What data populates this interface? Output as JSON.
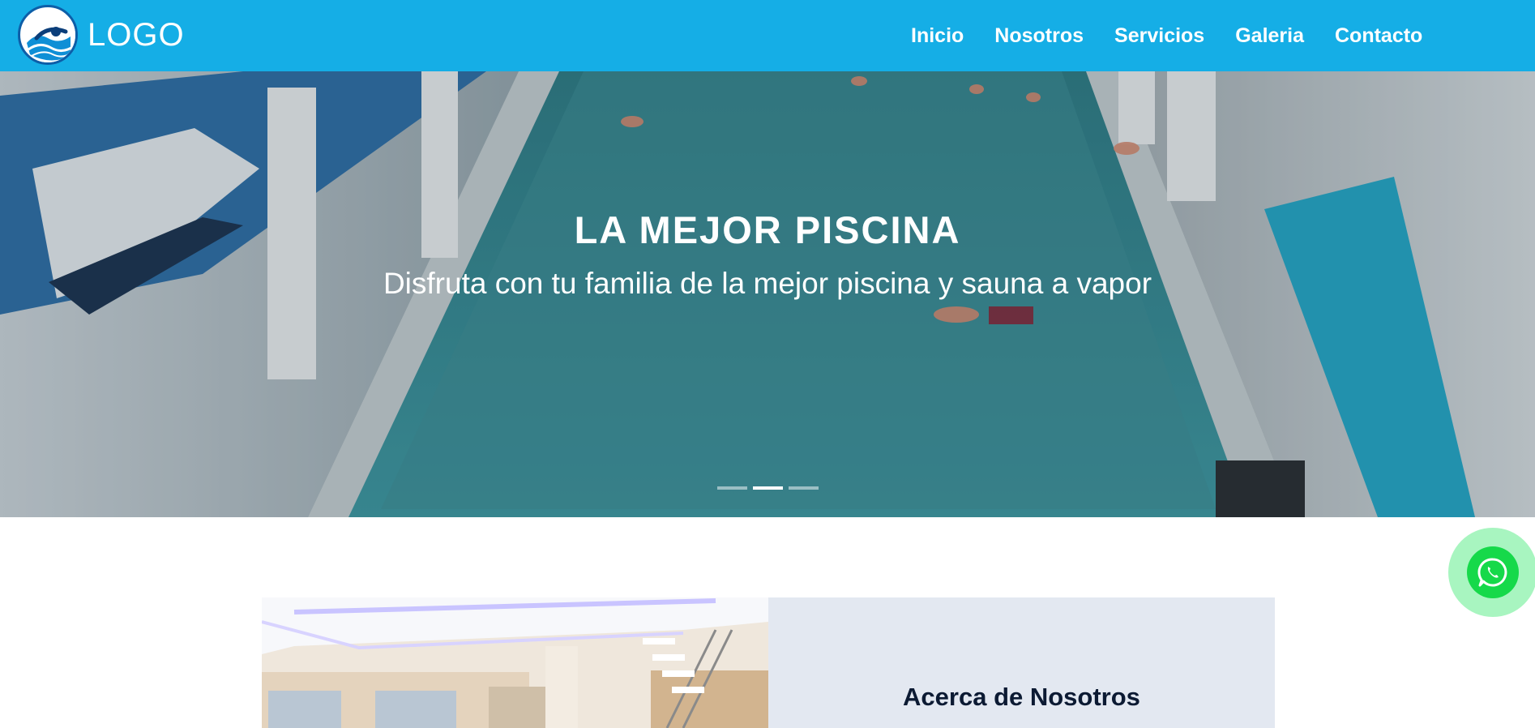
{
  "brand": {
    "logo_text": "LOGO",
    "logo_icon": "swimmer-wave-icon"
  },
  "nav": {
    "items": [
      {
        "label": "Inicio"
      },
      {
        "label": "Nosotros"
      },
      {
        "label": "Servicios"
      },
      {
        "label": "Galeria"
      },
      {
        "label": "Contacto"
      }
    ]
  },
  "hero": {
    "title": "LA MEJOR PISCINA",
    "subtitle": "Disfruta con tu familia de la mejor piscina y sauna a vapor",
    "slide_count": 3,
    "active_slide": 2
  },
  "about": {
    "heading": "Acerca de Nosotros"
  },
  "whatsapp": {
    "icon": "whatsapp-icon"
  },
  "colors": {
    "navbar": "#15aee6",
    "about_panel": "#e3e8f1",
    "heading_text": "#0c1a33",
    "whatsapp_green": "#16d94a",
    "whatsapp_halo": "#a8f5c0"
  }
}
